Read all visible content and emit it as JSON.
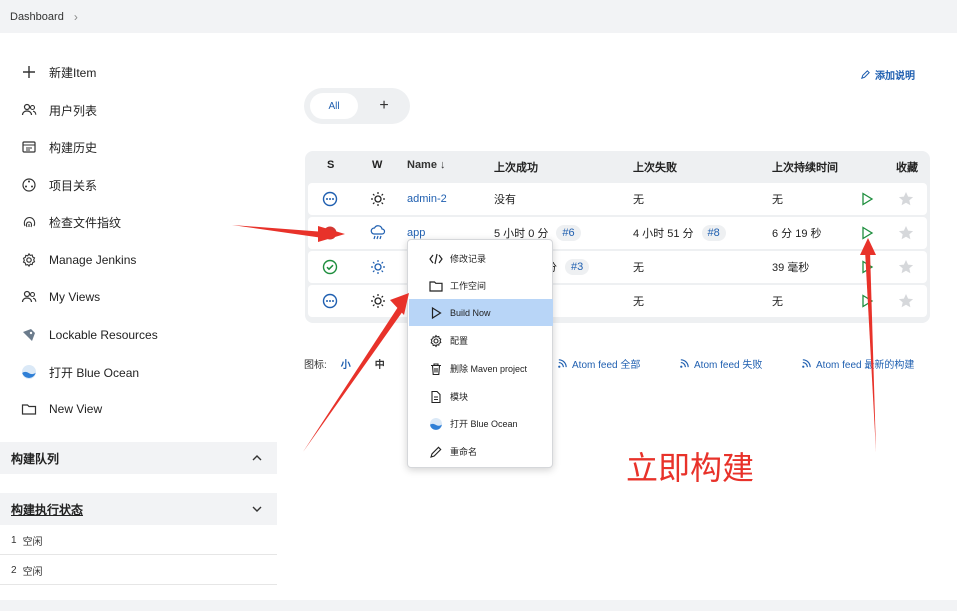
{
  "breadcrumb": {
    "items": [
      "Dashboard"
    ]
  },
  "sidebar": {
    "items": [
      {
        "label": "新建Item",
        "icon": "plus-icon"
      },
      {
        "label": "用户列表",
        "icon": "users-icon"
      },
      {
        "label": "构建历史",
        "icon": "history-icon"
      },
      {
        "label": "项目关系",
        "icon": "relationship-icon"
      },
      {
        "label": "检查文件指纹",
        "icon": "fingerprint-icon"
      },
      {
        "label": "Manage Jenkins",
        "icon": "gear-icon"
      },
      {
        "label": "My Views",
        "icon": "users-icon"
      },
      {
        "label": "Lockable Resources",
        "icon": "lock-icon"
      },
      {
        "label": "打开 Blue Ocean",
        "icon": "blue-ocean-icon"
      },
      {
        "label": "New View",
        "icon": "folder-icon"
      }
    ],
    "build_queue": {
      "title": "构建队列"
    },
    "executors": {
      "title": "构建执行状态",
      "rows": [
        {
          "num": "1",
          "state": "空闲"
        },
        {
          "num": "2",
          "state": "空闲"
        }
      ]
    }
  },
  "main": {
    "add_description": "添加说明",
    "tabs": {
      "all": "All",
      "add": "+"
    },
    "table": {
      "headers": {
        "s": "S",
        "w": "W",
        "name": "Name ↓",
        "last_success": "上次成功",
        "last_failure": "上次失败",
        "last_duration": "上次持续时间",
        "fav": "收藏"
      },
      "rows": [
        {
          "name": "admin-2",
          "last_success": "没有",
          "success_badge": "",
          "last_failure": "无",
          "failure_badge": "",
          "duration": "无"
        },
        {
          "name": "app",
          "last_success": "5 小时 0 分",
          "success_badge": "#6",
          "last_failure": "4 小时 51 分",
          "failure_badge": "#8",
          "duration": "6 分 19 秒"
        },
        {
          "name": "",
          "last_success": "分",
          "success_badge": "#3",
          "last_failure": "无",
          "failure_badge": "",
          "duration": "39 毫秒"
        },
        {
          "name": "",
          "last_success": "",
          "success_badge": "",
          "last_failure": "无",
          "failure_badge": "",
          "duration": "无"
        }
      ]
    },
    "legend": {
      "label": "图标:",
      "small": "小",
      "medium": "中"
    },
    "feeds": {
      "all": "Atom feed 全部",
      "failed": "Atom feed 失败",
      "latest": "Atom feed 最新的构建"
    }
  },
  "context_menu": {
    "items": [
      {
        "label": "修改记录",
        "icon": "code-icon"
      },
      {
        "label": "工作空间",
        "icon": "folder-icon"
      },
      {
        "label": "Build Now",
        "icon": "play-icon"
      },
      {
        "label": "配置",
        "icon": "gear-icon"
      },
      {
        "label": "删除 Maven project",
        "icon": "trash-icon"
      },
      {
        "label": "模块",
        "icon": "document-icon"
      },
      {
        "label": "打开 Blue Ocean",
        "icon": "blue-ocean-icon"
      },
      {
        "label": "重命名",
        "icon": "pencil-icon"
      }
    ]
  },
  "annotation": {
    "text": "立即构建",
    "color": "#e8322a"
  },
  "colors": {
    "link": "#1f5fb0",
    "success": "#1e8e3e",
    "play": "#1e8e3e",
    "highlight": "#b8d5f7"
  }
}
